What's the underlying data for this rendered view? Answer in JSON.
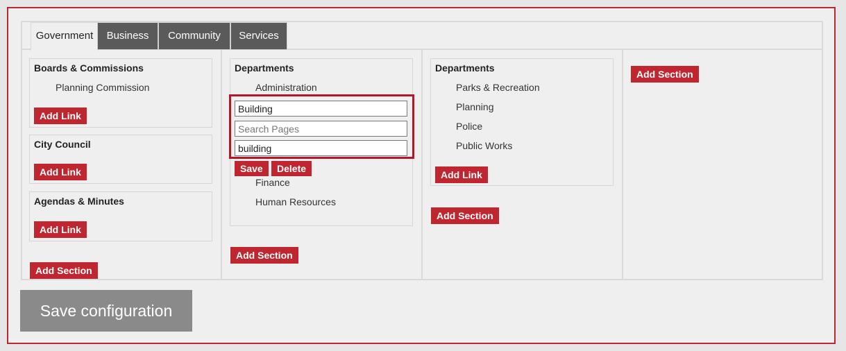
{
  "tabs": [
    {
      "label": "Government",
      "active": true
    },
    {
      "label": "Business",
      "active": false
    },
    {
      "label": "Community",
      "active": false
    },
    {
      "label": "Services",
      "active": false
    }
  ],
  "col1": {
    "sections": [
      {
        "title": "Boards & Commissions",
        "links": [
          "Planning Commission"
        ],
        "add_link": "Add Link"
      },
      {
        "title": "City Council",
        "links": [],
        "add_link": "Add Link"
      },
      {
        "title": "Agendas & Minutes",
        "links": [],
        "add_link": "Add Link"
      }
    ],
    "add_section": "Add Section"
  },
  "col2": {
    "section": {
      "title": "Departments",
      "links_before": [
        "Administration"
      ],
      "editor": {
        "title_value": "Building",
        "search_placeholder": "Search Pages",
        "url_value": "building",
        "save_label": "Save",
        "delete_label": "Delete"
      },
      "links_after": [
        "Finance",
        "Human Resources"
      ]
    },
    "add_section": "Add Section"
  },
  "col3": {
    "section": {
      "title": "Departments",
      "links": [
        "Parks & Recreation",
        "Planning",
        "Police",
        "Public Works"
      ],
      "add_link": "Add Link"
    },
    "add_section": "Add Section"
  },
  "col4": {
    "add_section": "Add Section"
  },
  "save_configuration": "Save configuration",
  "colors": {
    "accent_red": "#c0262f",
    "tab_dark": "#5a5a5a",
    "save_gray": "#8a8a8a"
  }
}
